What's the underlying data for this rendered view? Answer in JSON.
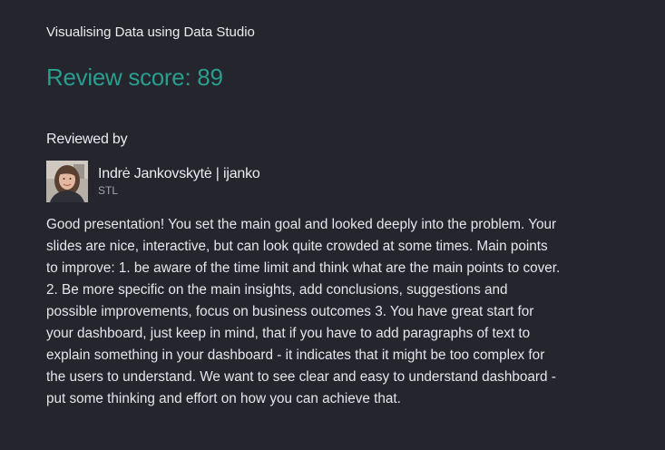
{
  "project": {
    "title": "Visualising Data using Data Studio"
  },
  "review": {
    "score_text": "Review score: 89",
    "reviewed_by_label": "Reviewed by",
    "reviewer": {
      "name": "Indrė Jankovskytė | ijanko",
      "role": "STL"
    },
    "body_lines": [
      "Good presentation! You set the main goal and looked deeply into the problem. Your",
      "slides are nice, interactive, but can look quite crowded at some times. Main points",
      "to improve: 1. be aware of the time limit and think what are the main points to cover.",
      "2. Be more specific on the main insights, add conclusions, suggestions and",
      "possible improvements, focus on business outcomes 3. You have great start for",
      "your dashboard, just keep in mind, that if you have to add paragraphs of text to",
      "explain something in your dashboard - it indicates that it might be too complex for",
      "the users to understand. We want to see clear and easy to understand dashboard -",
      "put some thinking and effort on how you can achieve that."
    ]
  },
  "colors": {
    "background": "#24252d",
    "score": "#2a9d8f",
    "text": "#e8e8ea",
    "muted": "#a3a4aa"
  }
}
